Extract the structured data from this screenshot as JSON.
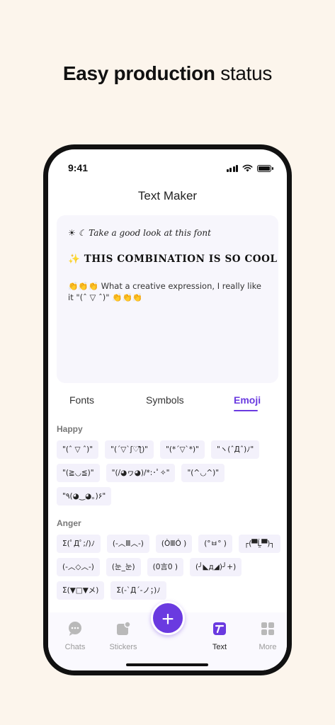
{
  "headline": {
    "bold": "Easy production",
    "light": "status"
  },
  "status_bar": {
    "time": "9:41"
  },
  "header": {
    "title": "Text Maker"
  },
  "preview": {
    "line1": "☀ ☾ Take a good look at this font",
    "line2": "✨ THIS COMBINATION IS SO COOL",
    "line3": "👏👏👏 What a creative expression, I really like it \"(ˆ ▽ ˆ)\" 👏👏👏"
  },
  "tabs": [
    "Fonts",
    "Symbols",
    "Emoji"
  ],
  "active_tab": "Emoji",
  "sections": [
    {
      "title": "Happy",
      "items": [
        "\"(ˆ ▽ ˆ)\"",
        "\"(´▽`ʃ♡ƪ)\"",
        "\"(*´▽`*)\"",
        "\"ヽ(ˆДˆ)ﾉ\"",
        "\"(≧◡≦)\"",
        "\"(/◕ヮ◕)/*:･ﾟ✧\"",
        "\"(^◡^)\"",
        "\"٩(◕‿◕｡)۶\""
      ]
    },
    {
      "title": "Anger",
      "items": [
        "Σ(ﾟДﾟ;/)ﾉ",
        "(-︿Ⅲ︿-)",
        "(ÒⅢÓ )",
        "(°ㅂ° )",
        "┌(▀Ĺ̯▀)┐",
        "(-︿◇︿-)",
        "(눈_눈)",
        "(0言0 )",
        "(╯◣д◢)╯+)",
        "Σ(▼□▼メ)",
        "Σ(-`Д´-ノ；)ﾉ"
      ]
    }
  ],
  "tabbar": {
    "items": [
      {
        "label": "Chats",
        "icon": "chat-bubble-icon"
      },
      {
        "label": "Stickers",
        "icon": "sticker-icon"
      },
      {
        "label": "Text",
        "icon": "text-icon"
      },
      {
        "label": "More",
        "icon": "grid-icon"
      }
    ],
    "active": "Text",
    "fab_icon": "plus-icon"
  },
  "colors": {
    "accent": "#6a3ae0",
    "background": "#fcf5ec",
    "chip": "#f3f1fb"
  }
}
